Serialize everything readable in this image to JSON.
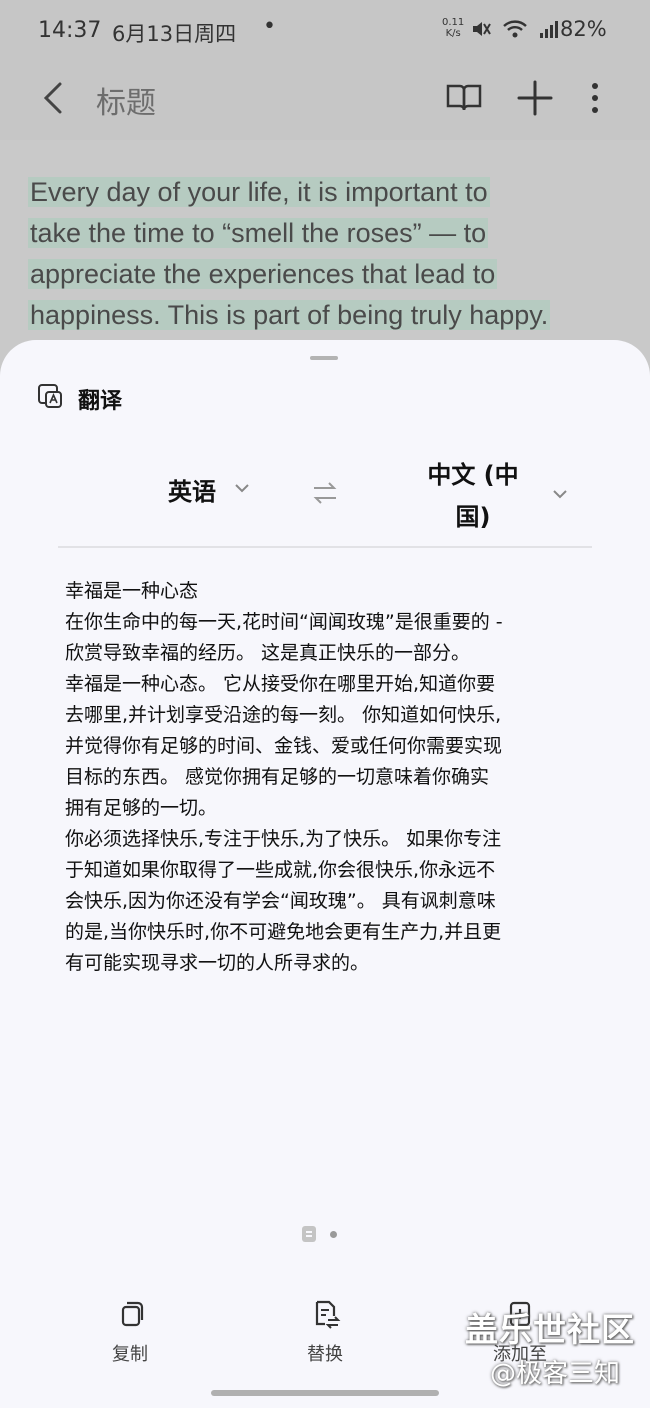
{
  "status": {
    "time": "14:37",
    "date": "6月13日周四",
    "dot": "•",
    "net_speed_value": "0.11",
    "net_speed_unit": "K/s",
    "battery": "82%",
    "icons": [
      "mute-icon",
      "wifi-icon",
      "signal-icon"
    ]
  },
  "appbar": {
    "title": "标题",
    "icons": [
      "back-icon",
      "book-icon",
      "plus-icon",
      "more-icon"
    ]
  },
  "note": {
    "lines": [
      "Every day of your life, it is important to",
      "take the time to “smell the roses” — to",
      "appreciate the experiences that lead to",
      "happiness. This is part of being truly happy."
    ],
    "highlight_color": "#b6cbc1"
  },
  "sheet": {
    "title": "翻译",
    "source_lang": "英语",
    "target_lang_line1": "中文 (中",
    "target_lang_line2": "国)",
    "translation_lines": [
      "幸福是一种心态",
      "在你生命中的每一天,花时间“闻闻玫瑰”是很重要的 -",
      "欣赏导致幸福的经历。 这是真正快乐的一部分。",
      "幸福是一种心态。 它从接受你在哪里开始,知道你要",
      "去哪里,并计划享受沿途的每一刻。 你知道如何快乐,",
      "并觉得你有足够的时间、金钱、爱或任何你需要实现",
      "目标的东西。 感觉你拥有足够的一切意味着你确实",
      "拥有足够的一切。",
      "你必须选择快乐,专注于快乐,为了快乐。 如果你专注",
      "于知道如果你取得了一些成就,你会很快乐,你永远不",
      "会快乐,因为你还没有学会“闻玫瑰”。 具有讽刺意味",
      "的是,当你快乐时,你不可避免地会更有生产力,并且更",
      "有可能实现寻求一切的人所寻求的。"
    ],
    "actions": {
      "copy": "复制",
      "replace": "替换",
      "add_to": "添加至"
    }
  },
  "watermark": {
    "line1": "盖乐世社区",
    "line2": "@极客三知"
  }
}
